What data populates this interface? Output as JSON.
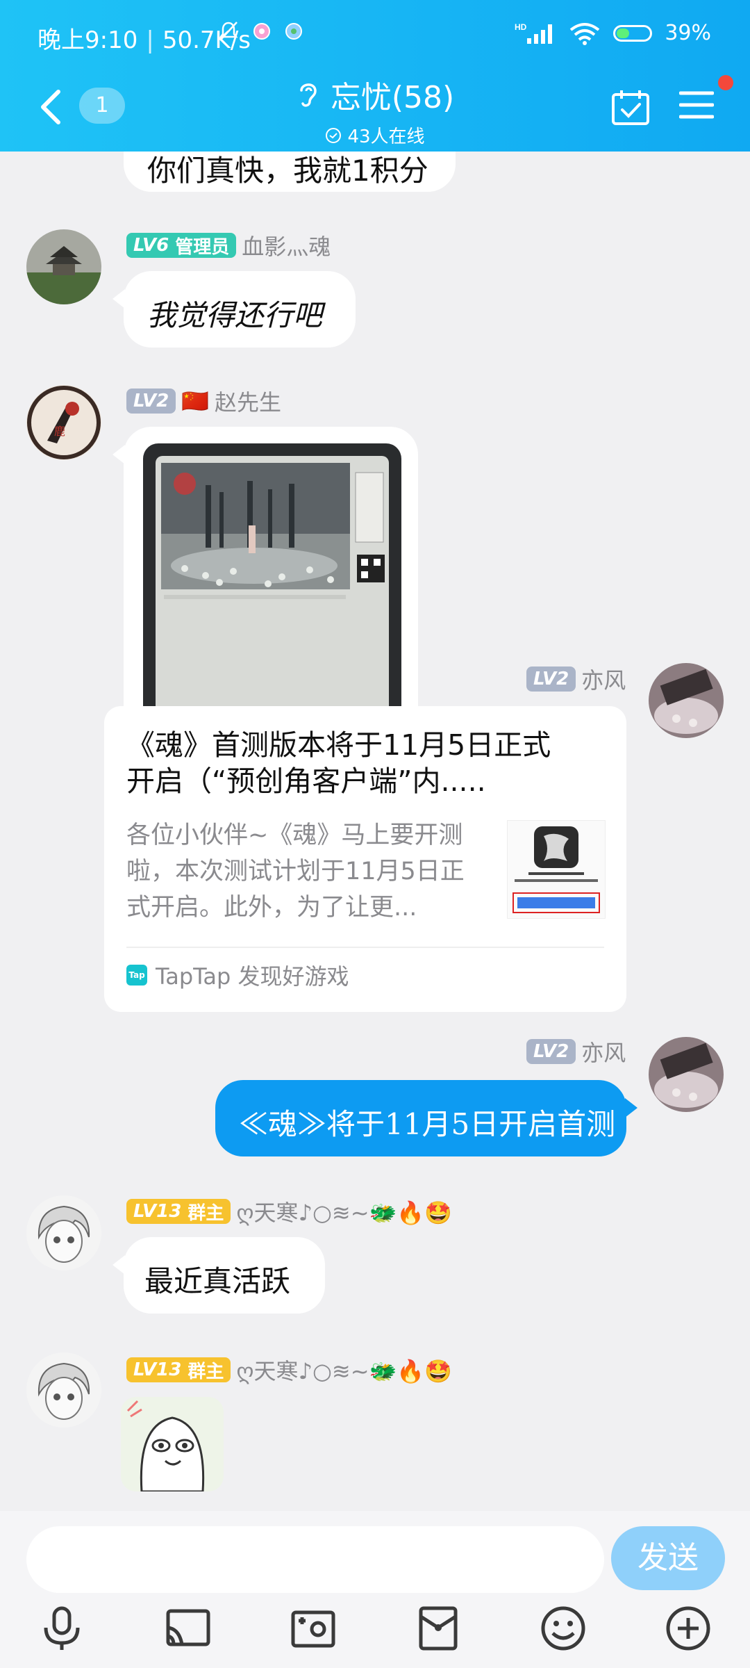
{
  "status_bar": {
    "time": "晚上9:10",
    "net_speed": "50.7K/s",
    "network": "HD",
    "battery": "39%",
    "battery_level": 0.39
  },
  "header": {
    "back_count": "1",
    "group_name": "忘忧(58)",
    "online": "43人在线"
  },
  "messages": [
    {
      "sender": "",
      "text": "你们真快，我就1积分"
    },
    {
      "level": "LV6",
      "role": "管理员",
      "sender": "血影灬魂",
      "text": "我觉得还行吧"
    },
    {
      "level": "LV2",
      "flag": "🇨🇳",
      "sender": "赵先生",
      "type": "image"
    },
    {
      "level": "LV2",
      "sender": "亦风",
      "type": "share",
      "card": {
        "title_line1": "《魂》首测版本将于11月5日正式",
        "title_line2": "开启（“预创角客户端”内.....",
        "desc_line1": "各位小伙伴~《魂》马上要开测",
        "desc_line2": "啦，本次测试计划于11月5日正",
        "desc_line3": "式开启。此外，为了让更...",
        "source": "TapTap 发现好游戏",
        "source_logo": "Tap"
      }
    },
    {
      "level": "LV2",
      "sender": "亦风",
      "text": "≪魂≫将于11月5日开启首测"
    },
    {
      "level": "LV13",
      "role": "群主",
      "sender": "ღ天寒♪○≋~🐲🔥🤩",
      "text": "最近真活跃"
    },
    {
      "level": "LV13",
      "role": "群主",
      "sender": "ღ天寒♪○≋~🐲🔥🤩",
      "type": "sticker"
    }
  ],
  "input": {
    "placeholder": "",
    "send_label": "发送"
  },
  "toolbar": [
    "microphone-icon",
    "screen-share-icon",
    "photo-icon",
    "red-packet-icon",
    "emoji-icon",
    "plus-icon"
  ],
  "colors": {
    "header_start": "#1fc3f6",
    "header_end": "#10a9f2",
    "my_bubble": "#0d9bf2",
    "send_button": "#8fd0fa",
    "badge_admin": "#34c9b2",
    "badge_owner": "#f7c22e",
    "badge_member": "#aab4c8",
    "notification_dot": "#f4483b"
  }
}
